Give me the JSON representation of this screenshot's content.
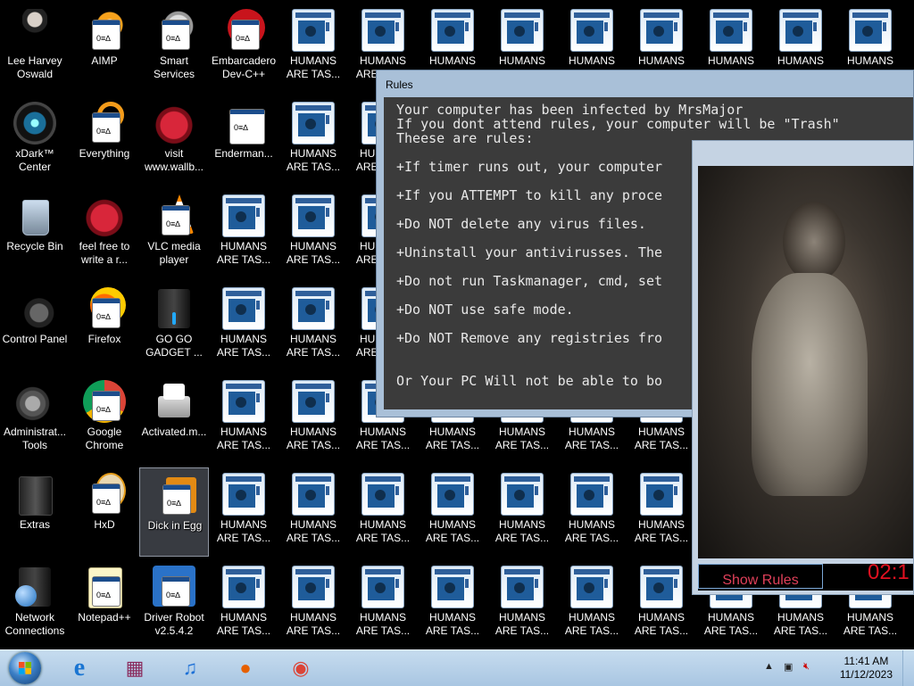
{
  "desktop": {
    "icons": [
      {
        "label": "Lee Harvey\nOswald",
        "icon": "person-icon"
      },
      {
        "label": "xDark™\nCenter",
        "icon": "orb-icon"
      },
      {
        "label": "Recycle Bin",
        "icon": "recycle-bin-icon"
      },
      {
        "label": "Control Panel",
        "icon": "control-panel-icon"
      },
      {
        "label": "Administrat...\nTools",
        "icon": "tools-icon"
      },
      {
        "label": "Extras",
        "icon": "folder-icon"
      },
      {
        "label": "Network\nConnections",
        "icon": "network-icon"
      },
      {
        "label": "AIMP",
        "icon": "app-icon"
      },
      {
        "label": "Everything",
        "icon": "app-icon"
      },
      {
        "label": "feel free to\nwrite a r...",
        "icon": "demon-icon"
      },
      {
        "label": "Firefox",
        "icon": "app-icon"
      },
      {
        "label": "Google\nChrome",
        "icon": "app-icon"
      },
      {
        "label": "HxD",
        "icon": "app-icon"
      },
      {
        "label": "Notepad++",
        "icon": "app-icon"
      },
      {
        "label": "Smart\nServices",
        "icon": "app-icon"
      },
      {
        "label": "visit\nwww.wallb...",
        "icon": "demon-icon"
      },
      {
        "label": "VLC media\nplayer",
        "icon": "app-icon"
      },
      {
        "label": "GO GO\nGADGET ...",
        "icon": "gadget-icon"
      },
      {
        "label": "Activated.m...",
        "icon": "printer-icon"
      },
      {
        "label": "Dick in Egg",
        "icon": "app-icon"
      },
      {
        "label": "Driver Robot\nv2.5.4.2",
        "icon": "app-icon"
      },
      {
        "label": "Embarcadero\nDev-C++",
        "icon": "app-icon"
      },
      {
        "label": "Enderman...",
        "icon": "app-icon"
      },
      {
        "label": "HUMANS\nARE TAS...",
        "icon": "window-icon"
      },
      {
        "label": "HUMANS",
        "icon": "window-icon"
      }
    ]
  },
  "rules_window": {
    "title": "Rules",
    "lines": [
      "Your computer has been infected by MrsMajor",
      "If you dont attend rules, your computer will be \"Trash\"",
      "Theese are rules:",
      "+If timer runs out, your computer",
      "+If you ATTEMPT to kill any proce",
      "+Do NOT delete any virus files.",
      "+Uninstall your antivirusses. The",
      "+Do not run Taskmanager, cmd, set",
      "+Do NOT use safe mode.",
      "+Do NOT Remove any registries fro",
      "Or Your PC Will not be able to bo"
    ]
  },
  "image_window": {
    "button_label": "Show Rules",
    "timer": "02:1"
  },
  "taskbar": {
    "apps": [
      {
        "name": "internet-explorer-icon",
        "glyph": "e",
        "color": "#1a75d2"
      },
      {
        "name": "winrar-icon",
        "glyph": "▦",
        "color": "#8a2c5e"
      },
      {
        "name": "music-icon",
        "glyph": "♫",
        "color": "#1b6fd6"
      },
      {
        "name": "firefox-icon",
        "glyph": "●",
        "color": "#e66000"
      },
      {
        "name": "chrome-icon",
        "glyph": "◉",
        "color": "#db4437"
      }
    ],
    "clock_time": "11:41 AM",
    "clock_date": "11/12/2023"
  }
}
